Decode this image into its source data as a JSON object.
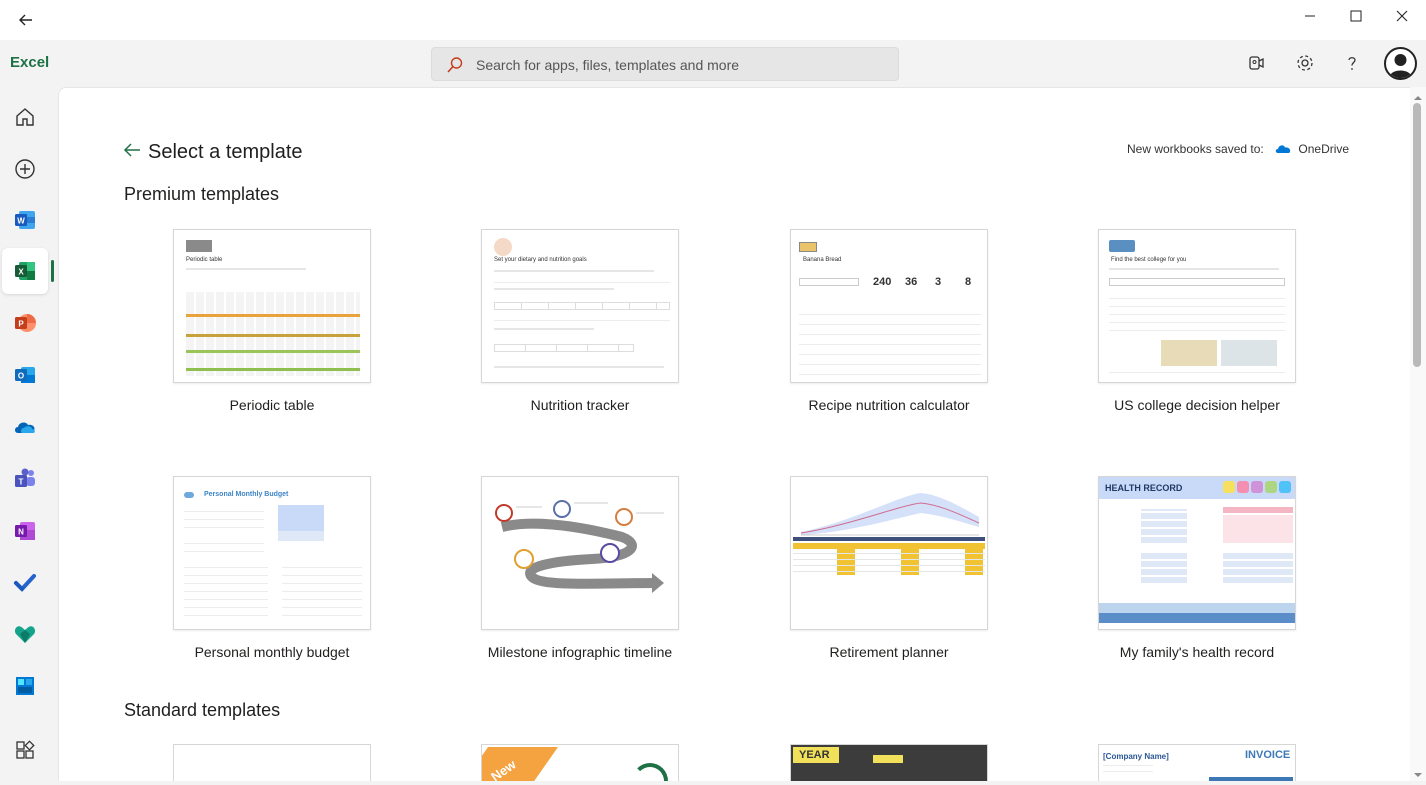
{
  "app": {
    "name": "Excel"
  },
  "search": {
    "placeholder": "Search for apps, files, templates and more"
  },
  "page": {
    "title": "Select a template",
    "saved_to_label": "New workbooks saved to:",
    "saved_to_location": "OneDrive"
  },
  "sections": {
    "premium": "Premium templates",
    "standard": "Standard templates"
  },
  "premium_templates": [
    {
      "label": "Periodic table",
      "thumb_title": "Periodic table"
    },
    {
      "label": "Nutrition tracker",
      "thumb_title": "Set your dietary and nutrition goals"
    },
    {
      "label": "Recipe nutrition calculator",
      "thumb_title": "Banana Bread"
    },
    {
      "label": "US college decision helper",
      "thumb_title": "Find the best college for you"
    },
    {
      "label": "Personal monthly budget",
      "thumb_title": "Personal Monthly Budget"
    },
    {
      "label": "Milestone infographic timeline",
      "thumb_title": ""
    },
    {
      "label": "Retirement planner",
      "thumb_title": ""
    },
    {
      "label": "My family's health record",
      "thumb_title": "HEALTH RECORD"
    }
  ],
  "standard_templates": [
    {
      "thumb_text": ""
    },
    {
      "thumb_text": "New"
    },
    {
      "thumb_text": "YEAR"
    },
    {
      "thumb_text": "[Company Name]",
      "thumb_text_2": "INVOICE"
    }
  ],
  "recipe_stats": [
    "240",
    "36",
    "3",
    "8"
  ],
  "colors": {
    "excel_green": "#1e7145",
    "word_blue": "#185abd",
    "ppt_orange": "#c43e1c",
    "outlook_blue": "#0f6cbd",
    "onedrive_blue": "#0364b8",
    "teams_purple": "#5b5fc7",
    "onenote_purple": "#7719aa"
  },
  "icons": {
    "nav": [
      "home-icon",
      "create-icon",
      "word-icon",
      "excel-icon",
      "powerpoint-icon",
      "outlook-icon",
      "onedrive-icon",
      "teams-icon",
      "onenote-icon",
      "todo-icon",
      "family-safety-icon",
      "azure-icon",
      "all-apps-icon"
    ]
  }
}
